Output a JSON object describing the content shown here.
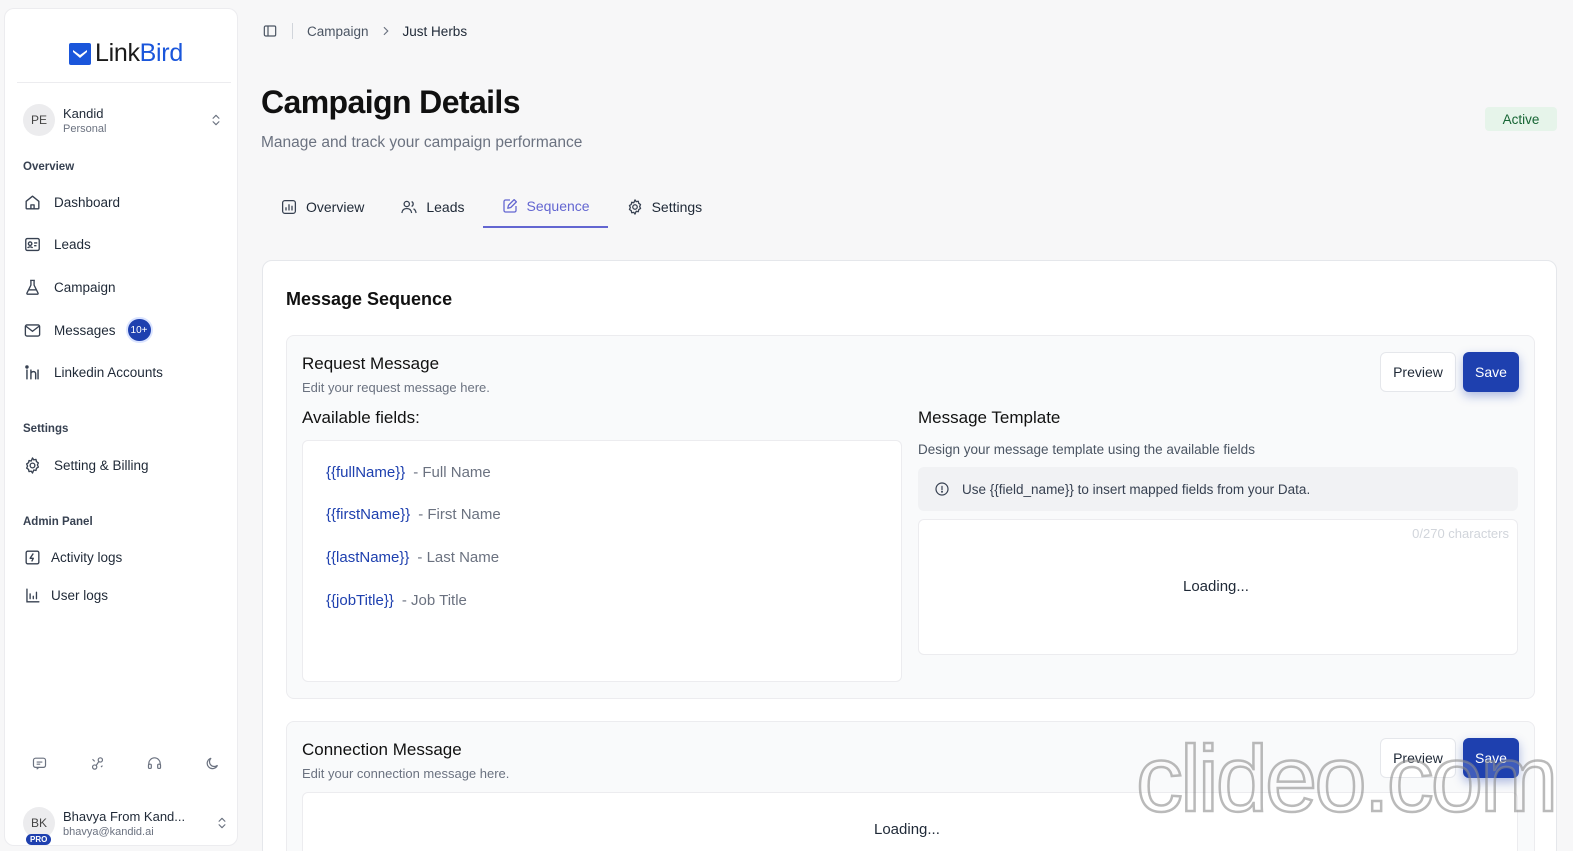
{
  "app": {
    "logo_prefix": "Link",
    "logo_suffix": "Bird"
  },
  "workspace": {
    "initials": "PE",
    "name": "Kandid",
    "type": "Personal"
  },
  "sidebar": {
    "overview_label": "Overview",
    "items": [
      {
        "label": "Dashboard",
        "icon": "home-icon"
      },
      {
        "label": "Leads",
        "icon": "contacts-icon"
      },
      {
        "label": "Campaign",
        "icon": "flask-icon"
      },
      {
        "label": "Messages",
        "icon": "mail-icon",
        "badge": "10+"
      },
      {
        "label": "Linkedin Accounts",
        "icon": "linkedin-icon"
      }
    ],
    "settings_label": "Settings",
    "settings_items": [
      {
        "label": "Setting & Billing",
        "icon": "gear-icon"
      }
    ],
    "admin_label": "Admin Panel",
    "admin_items": [
      {
        "label": "Activity logs",
        "icon": "activity-icon"
      },
      {
        "label": "User logs",
        "icon": "user-logs-icon"
      }
    ]
  },
  "user": {
    "initials": "BK",
    "plan": "PRO",
    "name": "Bhavya From Kand...",
    "email": "bhavya@kandid.ai"
  },
  "breadcrumb": {
    "parent": "Campaign",
    "current": "Just Herbs"
  },
  "page": {
    "title": "Campaign Details",
    "subtitle": "Manage and track your campaign performance",
    "status": "Active"
  },
  "tabs": [
    {
      "label": "Overview",
      "icon": "overview-icon",
      "active": false
    },
    {
      "label": "Leads",
      "icon": "users-icon",
      "active": false
    },
    {
      "label": "Sequence",
      "icon": "sequence-icon",
      "active": true
    },
    {
      "label": "Settings",
      "icon": "gear-icon",
      "active": false
    }
  ],
  "sequence": {
    "title": "Message Sequence",
    "request": {
      "title": "Request Message",
      "subtitle": "Edit your request message here.",
      "preview_label": "Preview",
      "save_label": "Save",
      "available_title": "Available fields:",
      "fields": [
        {
          "key": "{{fullName}}",
          "desc": "- Full Name"
        },
        {
          "key": "{{firstName}}",
          "desc": "- First Name"
        },
        {
          "key": "{{lastName}}",
          "desc": "- Last Name"
        },
        {
          "key": "{{jobTitle}}",
          "desc": "- Job Title"
        }
      ],
      "template_title": "Message Template",
      "template_subtitle": "Design your message template using the available fields",
      "template_hint": "Use {{field_name}} to insert mapped fields from your Data.",
      "char_count": "0/270 characters",
      "loading": "Loading..."
    },
    "connection": {
      "title": "Connection Message",
      "subtitle": "Edit your connection message here.",
      "preview_label": "Preview",
      "save_label": "Save",
      "loading": "Loading..."
    }
  },
  "watermark": "clideo.com",
  "colors": {
    "brand": "#1a56db",
    "primary_button": "#1e40af",
    "active_tab": "#6366d1",
    "status_bg": "#e6f4ea",
    "status_text": "#166534"
  }
}
